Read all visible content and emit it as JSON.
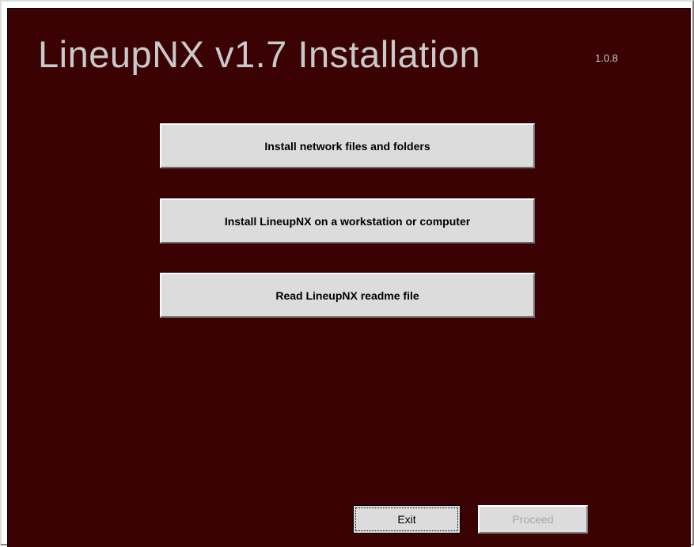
{
  "window": {
    "title": "LineupNX v1.7 Installation",
    "version": "1.0.8"
  },
  "actions": {
    "install_network": "Install network files and folders",
    "install_workstation": "Install LineupNX on a workstation or computer",
    "read_readme": "Read LineupNX readme file"
  },
  "footer": {
    "exit_label": "Exit",
    "proceed_label": "Proceed",
    "proceed_enabled": false
  },
  "colors": {
    "background": "#3a0202",
    "button_face": "#dcdcdc",
    "title_text": "#c9c9c9",
    "disabled_text": "#a8a8a8"
  }
}
